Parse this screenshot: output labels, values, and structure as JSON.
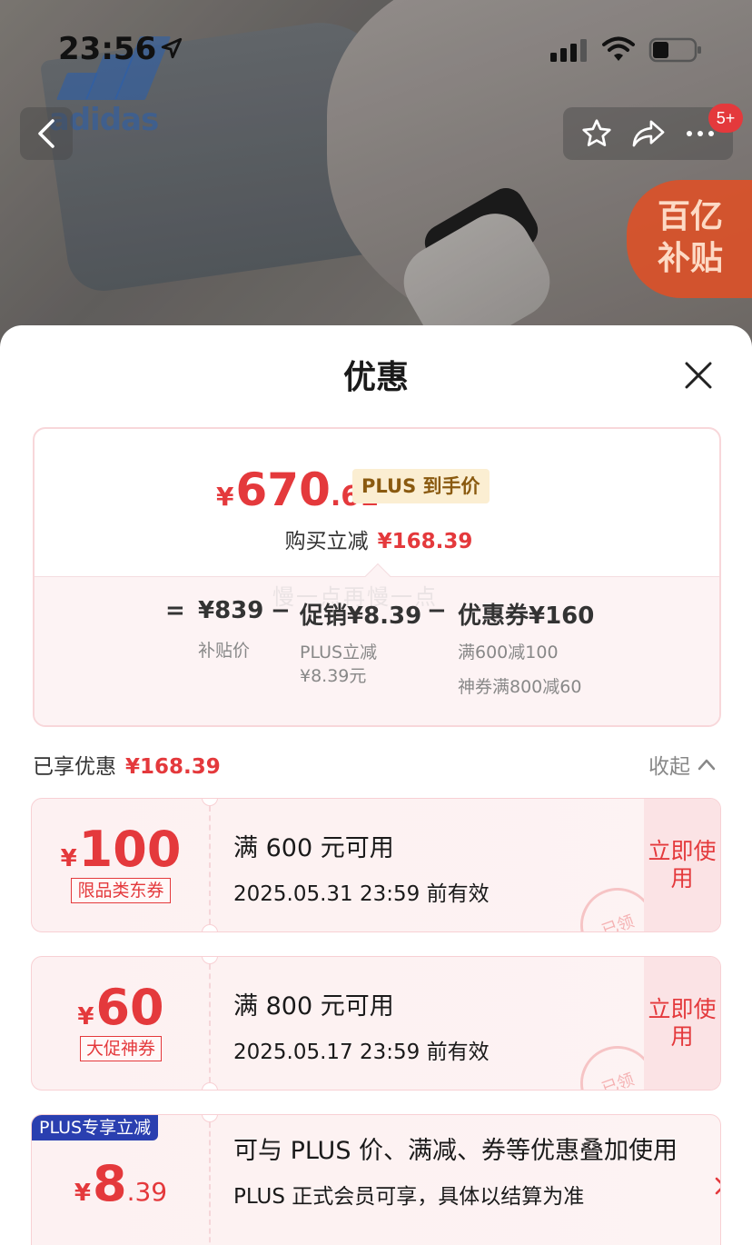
{
  "status_bar": {
    "time": "23:56"
  },
  "background": {
    "logo_text": "adidas",
    "subsidy_line1": "百亿",
    "subsidy_line2": "补贴"
  },
  "nav": {
    "badge": "5+"
  },
  "sheet": {
    "title": "优惠",
    "summary": {
      "yen": "¥",
      "price_int": "670",
      "price_dec": ".61",
      "plus_tag": "PLUS 到手价",
      "reduce_label": "购买立减",
      "reduce_amount": "¥168.39",
      "watermark": "慢一点再慢一点",
      "eq": "=",
      "base_price": "¥839",
      "base_label": "补贴价",
      "minus1": "−",
      "promo": "促销¥8.39",
      "promo_detail_1": "PLUS立减",
      "promo_detail_2": "¥8.39元",
      "minus2": "−",
      "coupon": "优惠券¥160",
      "coupon_detail_1": "满600减100",
      "coupon_detail_2": "神券满800减60"
    },
    "enjoyed": {
      "label": "已享优惠",
      "amount": "¥168.39",
      "collapse": "收起"
    },
    "coupons": [
      {
        "yen": "¥",
        "int": "100",
        "dec": "",
        "tag": "限品类东券",
        "condition": "满 600 元可用",
        "valid": "2025.05.31 23:59 前有效",
        "action": "立即使用",
        "stamp": "已领"
      },
      {
        "yen": "¥",
        "int": "60",
        "dec": "",
        "tag": "大促神券",
        "condition": "满 800 元可用",
        "valid": "2025.05.17 23:59 前有效",
        "action": "立即使用",
        "stamp": "已领"
      }
    ],
    "plus_coupon": {
      "label": "PLUS专享立减",
      "yen": "¥",
      "int": "8",
      "dec": ".39",
      "condition": "可与 PLUS 价、满减、券等优惠叠加使用",
      "note": "PLUS 正式会员可享，具体以结算为准"
    }
  },
  "colors": {
    "accent": "#e4393c",
    "plus_blue": "#2a3fb0",
    "plus_gold_bg": "#fbeed2"
  },
  "icons": [
    "location-arrow-icon",
    "signal-icon",
    "wifi-icon",
    "battery-icon",
    "back-chevron-icon",
    "star-icon",
    "share-icon",
    "more-icon",
    "close-icon",
    "chevron-up-icon",
    "chevron-right-icon"
  ]
}
